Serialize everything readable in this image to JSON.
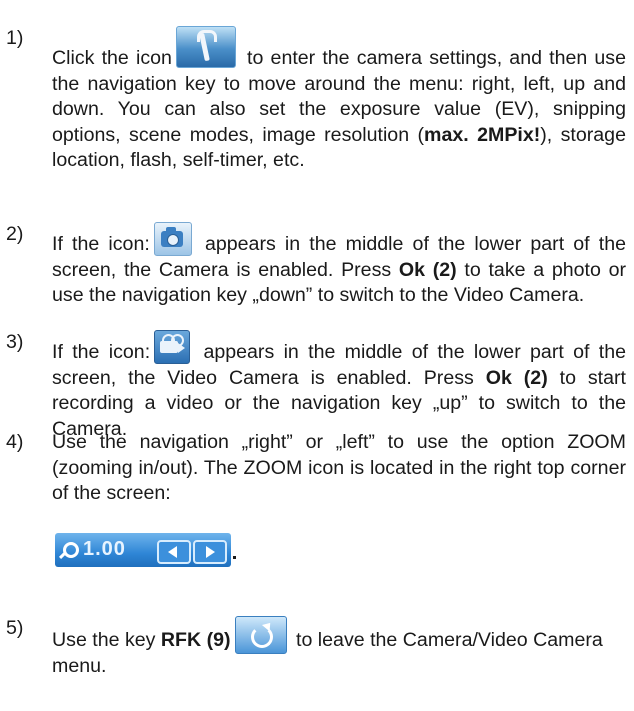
{
  "items": [
    {
      "number": "1)",
      "before_icon": "Click the icon",
      "icon": "tools-icon",
      "after_icon": " to enter the camera settings, and then use the navigation key to move around the menu: right, left, up and down. You can also set the exposure value (EV), snipping options, scene modes, image resolution (",
      "bold": "max. 2MPix!",
      "end": "), storage location, flash, self-timer, etc."
    },
    {
      "number": "2)",
      "before_icon": "If the icon:",
      "icon": "camera-icon",
      "after_icon": " appears in the middle of the lower part of the screen, the Camera is enabled. Press ",
      "bold": "Ok (2)",
      "end": " to take a photo or use the navigation key „down” to switch to the Video Camera."
    },
    {
      "number": "3)",
      "before_icon": "If the icon:",
      "icon": "video-camera-icon",
      "after_icon": " appears in the middle of the lower part of the screen, the Video Camera is enabled. Press ",
      "bold": "Ok (2)",
      "end": " to start recording a video or the navigation key „up” to switch to the Camera."
    },
    {
      "number": "4)",
      "text": "Use the navigation „right” or „left” to use the option ZOOM (zooming in/out). The ZOOM icon is located in the right top corner of the screen:",
      "zoom_value": "1.00",
      "icon": "zoom-indicator-icon"
    },
    {
      "number": "5)",
      "before": "Use the key ",
      "bold": "RFK (9)",
      "icon": "return-icon",
      "after_icon": " to leave the Camera/Video Camera menu."
    }
  ]
}
